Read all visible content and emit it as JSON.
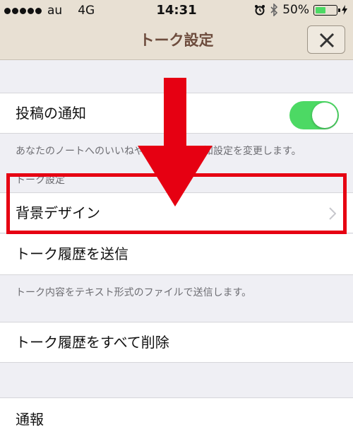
{
  "status_bar": {
    "carrier": "au",
    "network": "4G",
    "time": "14:31",
    "battery_percent": "50%",
    "battery_level": 0.5
  },
  "nav": {
    "title": "トーク設定",
    "close_icon": "close-icon"
  },
  "rows": {
    "post_notification": {
      "label": "投稿の通知",
      "toggle_on": true
    },
    "post_notification_note": "あなたのノートへのいいねやコメントの通知設定を変更します。",
    "section_header": "トーク設定",
    "background_design": {
      "label": "背景デザイン"
    },
    "send_history": {
      "label": "トーク履歴を送信"
    },
    "send_history_note": "トーク内容をテキスト形式のファイルで送信します。",
    "delete_history": {
      "label": "トーク履歴をすべて削除"
    },
    "report": {
      "label": "通報"
    }
  },
  "colors": {
    "toggle_on": "#4cd964",
    "highlight": "#e60012",
    "nav_title": "#6d4c3d"
  }
}
